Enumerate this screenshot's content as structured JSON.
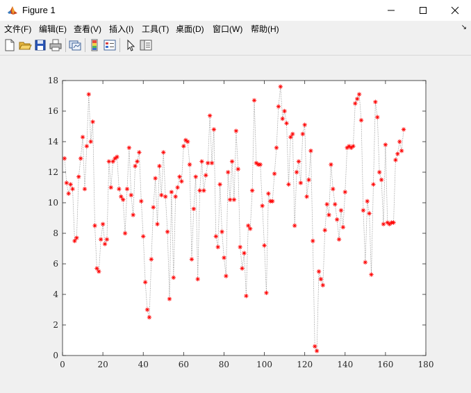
{
  "window": {
    "title": "Figure 1",
    "controls": [
      "minimize",
      "maximize",
      "close"
    ]
  },
  "menubar": {
    "items": [
      "文件(F)",
      "编辑(E)",
      "查看(V)",
      "插入(I)",
      "工具(T)",
      "桌面(D)",
      "窗口(W)",
      "帮助(H)"
    ]
  },
  "toolbar": {
    "icons": [
      "new-figure-icon",
      "open-file-icon",
      "save-icon",
      "print-icon",
      "link-plot-icon",
      "colorbar-icon",
      "legend-icon",
      "select-pointer-icon",
      "property-editor-icon"
    ]
  },
  "chart_data": {
    "type": "line",
    "marker": "*",
    "line_style": "dotted",
    "line_color": "#7f7f7f",
    "marker_color": "#ff0000",
    "xlim": [
      0,
      180
    ],
    "ylim": [
      0,
      18
    ],
    "xticks": [
      0,
      20,
      40,
      60,
      80,
      100,
      120,
      140,
      160,
      180
    ],
    "yticks": [
      0,
      2,
      4,
      6,
      8,
      10,
      12,
      14,
      16,
      18
    ],
    "grid": false,
    "series": [
      {
        "values": [
          12.9,
          11.3,
          10.6,
          11.2,
          10.9,
          7.5,
          7.7,
          11.7,
          12.9,
          14.3,
          10.9,
          13.7,
          17.1,
          14.0,
          15.3,
          8.5,
          5.7,
          5.5,
          7.6,
          8.6,
          7.3,
          7.6,
          12.7,
          11.0,
          12.7,
          12.9,
          13.0,
          10.9,
          10.4,
          10.2,
          8.0,
          10.9,
          13.6,
          10.5,
          9.2,
          12.4,
          12.7,
          13.3,
          10.1,
          7.8,
          4.8,
          3.0,
          2.5,
          6.3,
          9.7,
          11.6,
          8.6,
          12.4,
          10.5,
          13.3,
          10.4,
          8.1,
          3.7,
          10.7,
          5.1,
          10.4,
          11.0,
          11.7,
          11.4,
          13.7,
          14.1,
          14.0,
          12.5,
          6.3,
          9.6,
          11.7,
          5.0,
          10.8,
          12.7,
          10.8,
          11.8,
          12.6,
          15.7,
          12.6,
          14.8,
          7.8,
          7.1,
          11.2,
          8.1,
          6.4,
          5.2,
          12.0,
          10.2,
          12.7,
          10.2,
          14.7,
          12.2,
          7.1,
          5.7,
          6.7,
          3.9,
          8.5,
          8.3,
          10.8,
          16.7,
          12.6,
          12.5,
          12.5,
          9.8,
          7.2,
          4.1,
          10.6,
          10.1,
          10.1,
          11.9,
          13.6,
          16.3,
          17.6,
          15.5,
          16.0,
          15.2,
          11.2,
          14.3,
          14.5,
          8.5,
          12.0,
          12.7,
          11.3,
          14.5,
          15.1,
          10.4,
          11.5,
          13.4,
          7.5,
          0.6,
          0.3,
          5.5,
          5.0,
          4.6,
          8.2,
          9.9,
          9.2,
          12.5,
          10.9,
          9.9,
          8.9,
          7.6,
          9.5,
          8.4,
          10.7,
          13.6,
          13.7,
          13.6,
          13.7,
          16.5,
          16.8,
          17.1,
          15.4,
          9.5,
          6.1,
          10.1,
          9.3,
          5.3,
          11.2,
          16.6,
          15.6,
          12.0,
          11.5,
          8.6,
          13.8,
          8.7,
          8.6,
          8.7,
          8.7,
          12.8,
          13.2,
          14.0,
          13.4,
          14.8
        ]
      }
    ]
  }
}
